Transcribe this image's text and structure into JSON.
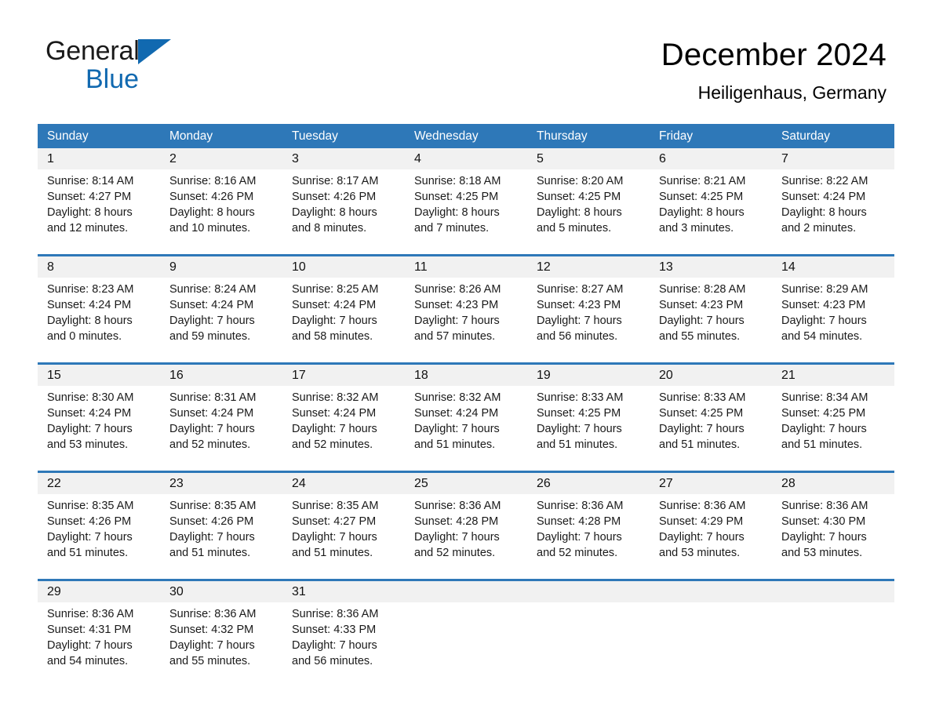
{
  "brand": {
    "word_general": "General",
    "word_blue": "Blue",
    "mark": "triangle-logo"
  },
  "header": {
    "title": "December 2024",
    "subtitle": "Heiligenhaus, Germany"
  },
  "colors": {
    "header_blue": "#2e78b8",
    "row_divider_blue": "#2e78b8",
    "daynum_band": "#f1f1f1",
    "brand_blue": "#1169b0",
    "text": "#1a1a1a"
  },
  "weekdays": [
    "Sunday",
    "Monday",
    "Tuesday",
    "Wednesday",
    "Thursday",
    "Friday",
    "Saturday"
  ],
  "weeks": [
    {
      "days": [
        {
          "num": "1",
          "sunrise": "Sunrise: 8:14 AM",
          "sunset": "Sunset: 4:27 PM",
          "daylight1": "Daylight: 8 hours",
          "daylight2": "and 12 minutes."
        },
        {
          "num": "2",
          "sunrise": "Sunrise: 8:16 AM",
          "sunset": "Sunset: 4:26 PM",
          "daylight1": "Daylight: 8 hours",
          "daylight2": "and 10 minutes."
        },
        {
          "num": "3",
          "sunrise": "Sunrise: 8:17 AM",
          "sunset": "Sunset: 4:26 PM",
          "daylight1": "Daylight: 8 hours",
          "daylight2": "and 8 minutes."
        },
        {
          "num": "4",
          "sunrise": "Sunrise: 8:18 AM",
          "sunset": "Sunset: 4:25 PM",
          "daylight1": "Daylight: 8 hours",
          "daylight2": "and 7 minutes."
        },
        {
          "num": "5",
          "sunrise": "Sunrise: 8:20 AM",
          "sunset": "Sunset: 4:25 PM",
          "daylight1": "Daylight: 8 hours",
          "daylight2": "and 5 minutes."
        },
        {
          "num": "6",
          "sunrise": "Sunrise: 8:21 AM",
          "sunset": "Sunset: 4:25 PM",
          "daylight1": "Daylight: 8 hours",
          "daylight2": "and 3 minutes."
        },
        {
          "num": "7",
          "sunrise": "Sunrise: 8:22 AM",
          "sunset": "Sunset: 4:24 PM",
          "daylight1": "Daylight: 8 hours",
          "daylight2": "and 2 minutes."
        }
      ]
    },
    {
      "days": [
        {
          "num": "8",
          "sunrise": "Sunrise: 8:23 AM",
          "sunset": "Sunset: 4:24 PM",
          "daylight1": "Daylight: 8 hours",
          "daylight2": "and 0 minutes."
        },
        {
          "num": "9",
          "sunrise": "Sunrise: 8:24 AM",
          "sunset": "Sunset: 4:24 PM",
          "daylight1": "Daylight: 7 hours",
          "daylight2": "and 59 minutes."
        },
        {
          "num": "10",
          "sunrise": "Sunrise: 8:25 AM",
          "sunset": "Sunset: 4:24 PM",
          "daylight1": "Daylight: 7 hours",
          "daylight2": "and 58 minutes."
        },
        {
          "num": "11",
          "sunrise": "Sunrise: 8:26 AM",
          "sunset": "Sunset: 4:23 PM",
          "daylight1": "Daylight: 7 hours",
          "daylight2": "and 57 minutes."
        },
        {
          "num": "12",
          "sunrise": "Sunrise: 8:27 AM",
          "sunset": "Sunset: 4:23 PM",
          "daylight1": "Daylight: 7 hours",
          "daylight2": "and 56 minutes."
        },
        {
          "num": "13",
          "sunrise": "Sunrise: 8:28 AM",
          "sunset": "Sunset: 4:23 PM",
          "daylight1": "Daylight: 7 hours",
          "daylight2": "and 55 minutes."
        },
        {
          "num": "14",
          "sunrise": "Sunrise: 8:29 AM",
          "sunset": "Sunset: 4:23 PM",
          "daylight1": "Daylight: 7 hours",
          "daylight2": "and 54 minutes."
        }
      ]
    },
    {
      "days": [
        {
          "num": "15",
          "sunrise": "Sunrise: 8:30 AM",
          "sunset": "Sunset: 4:24 PM",
          "daylight1": "Daylight: 7 hours",
          "daylight2": "and 53 minutes."
        },
        {
          "num": "16",
          "sunrise": "Sunrise: 8:31 AM",
          "sunset": "Sunset: 4:24 PM",
          "daylight1": "Daylight: 7 hours",
          "daylight2": "and 52 minutes."
        },
        {
          "num": "17",
          "sunrise": "Sunrise: 8:32 AM",
          "sunset": "Sunset: 4:24 PM",
          "daylight1": "Daylight: 7 hours",
          "daylight2": "and 52 minutes."
        },
        {
          "num": "18",
          "sunrise": "Sunrise: 8:32 AM",
          "sunset": "Sunset: 4:24 PM",
          "daylight1": "Daylight: 7 hours",
          "daylight2": "and 51 minutes."
        },
        {
          "num": "19",
          "sunrise": "Sunrise: 8:33 AM",
          "sunset": "Sunset: 4:25 PM",
          "daylight1": "Daylight: 7 hours",
          "daylight2": "and 51 minutes."
        },
        {
          "num": "20",
          "sunrise": "Sunrise: 8:33 AM",
          "sunset": "Sunset: 4:25 PM",
          "daylight1": "Daylight: 7 hours",
          "daylight2": "and 51 minutes."
        },
        {
          "num": "21",
          "sunrise": "Sunrise: 8:34 AM",
          "sunset": "Sunset: 4:25 PM",
          "daylight1": "Daylight: 7 hours",
          "daylight2": "and 51 minutes."
        }
      ]
    },
    {
      "days": [
        {
          "num": "22",
          "sunrise": "Sunrise: 8:35 AM",
          "sunset": "Sunset: 4:26 PM",
          "daylight1": "Daylight: 7 hours",
          "daylight2": "and 51 minutes."
        },
        {
          "num": "23",
          "sunrise": "Sunrise: 8:35 AM",
          "sunset": "Sunset: 4:26 PM",
          "daylight1": "Daylight: 7 hours",
          "daylight2": "and 51 minutes."
        },
        {
          "num": "24",
          "sunrise": "Sunrise: 8:35 AM",
          "sunset": "Sunset: 4:27 PM",
          "daylight1": "Daylight: 7 hours",
          "daylight2": "and 51 minutes."
        },
        {
          "num": "25",
          "sunrise": "Sunrise: 8:36 AM",
          "sunset": "Sunset: 4:28 PM",
          "daylight1": "Daylight: 7 hours",
          "daylight2": "and 52 minutes."
        },
        {
          "num": "26",
          "sunrise": "Sunrise: 8:36 AM",
          "sunset": "Sunset: 4:28 PM",
          "daylight1": "Daylight: 7 hours",
          "daylight2": "and 52 minutes."
        },
        {
          "num": "27",
          "sunrise": "Sunrise: 8:36 AM",
          "sunset": "Sunset: 4:29 PM",
          "daylight1": "Daylight: 7 hours",
          "daylight2": "and 53 minutes."
        },
        {
          "num": "28",
          "sunrise": "Sunrise: 8:36 AM",
          "sunset": "Sunset: 4:30 PM",
          "daylight1": "Daylight: 7 hours",
          "daylight2": "and 53 minutes."
        }
      ]
    },
    {
      "days": [
        {
          "num": "29",
          "sunrise": "Sunrise: 8:36 AM",
          "sunset": "Sunset: 4:31 PM",
          "daylight1": "Daylight: 7 hours",
          "daylight2": "and 54 minutes."
        },
        {
          "num": "30",
          "sunrise": "Sunrise: 8:36 AM",
          "sunset": "Sunset: 4:32 PM",
          "daylight1": "Daylight: 7 hours",
          "daylight2": "and 55 minutes."
        },
        {
          "num": "31",
          "sunrise": "Sunrise: 8:36 AM",
          "sunset": "Sunset: 4:33 PM",
          "daylight1": "Daylight: 7 hours",
          "daylight2": "and 56 minutes."
        },
        {
          "num": "",
          "sunrise": "",
          "sunset": "",
          "daylight1": "",
          "daylight2": ""
        },
        {
          "num": "",
          "sunrise": "",
          "sunset": "",
          "daylight1": "",
          "daylight2": ""
        },
        {
          "num": "",
          "sunrise": "",
          "sunset": "",
          "daylight1": "",
          "daylight2": ""
        },
        {
          "num": "",
          "sunrise": "",
          "sunset": "",
          "daylight1": "",
          "daylight2": ""
        }
      ]
    }
  ]
}
